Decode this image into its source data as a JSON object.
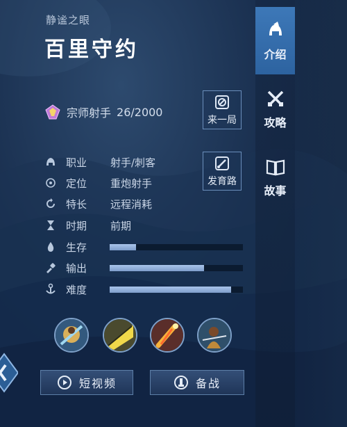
{
  "hero": {
    "subtitle": "静谧之眼",
    "name": "百里守约"
  },
  "rank": {
    "icon": "diamond-rank-icon",
    "label": "宗师射手",
    "score": "26/2000"
  },
  "actions": {
    "play_again": "来一局",
    "growth_path": "发育路",
    "short_video": "短视频",
    "prepare": "备战"
  },
  "attributes": {
    "role_key": "职业",
    "role_value": "射手/刺客",
    "position_key": "定位",
    "position_value": "重炮射手",
    "specialty_key": "特长",
    "specialty_value": "远程消耗",
    "phase_key": "时期",
    "phase_value": "前期"
  },
  "stats": [
    {
      "key": "生存",
      "value": 0.2
    },
    {
      "key": "输出",
      "value": 0.71
    },
    {
      "key": "难度",
      "value": 0.91
    }
  ],
  "skills": [
    "skill-1-icon",
    "skill-2-icon",
    "skill-3-icon",
    "skill-4-icon"
  ],
  "nav": {
    "intro": "介绍",
    "strategy": "攻略",
    "story": "故事",
    "active": "intro"
  },
  "colors": {
    "accent": "#3d78b8",
    "bar_fill": "#a9c4ea",
    "bar_track": "#0b1b30"
  }
}
